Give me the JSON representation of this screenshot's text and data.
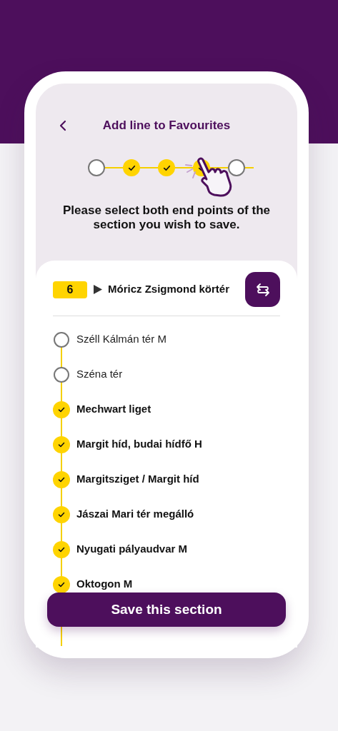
{
  "header": {
    "title": "Add line to Favourites"
  },
  "stepper": [
    {
      "selected": false
    },
    {
      "selected": true
    },
    {
      "selected": true
    },
    {
      "selected": true
    },
    {
      "selected": false
    }
  ],
  "message": "Please select both end points of the section you wish to save.",
  "line": {
    "number": "6",
    "direction": "Móricz Zsigmond körtér"
  },
  "stops": [
    {
      "name": "Széll Kálmán tér M",
      "selected": false
    },
    {
      "name": "Széna tér",
      "selected": false
    },
    {
      "name": "Mechwart liget",
      "selected": true
    },
    {
      "name": "Margit híd, budai hídfő H",
      "selected": true
    },
    {
      "name": "Margitsziget / Margit híd",
      "selected": true
    },
    {
      "name": "Jászai Mari tér megálló",
      "selected": true
    },
    {
      "name": "Nyugati pályaudvar M",
      "selected": true
    },
    {
      "name": "Oktogon M",
      "selected": true
    }
  ],
  "save_button": "Save this section"
}
